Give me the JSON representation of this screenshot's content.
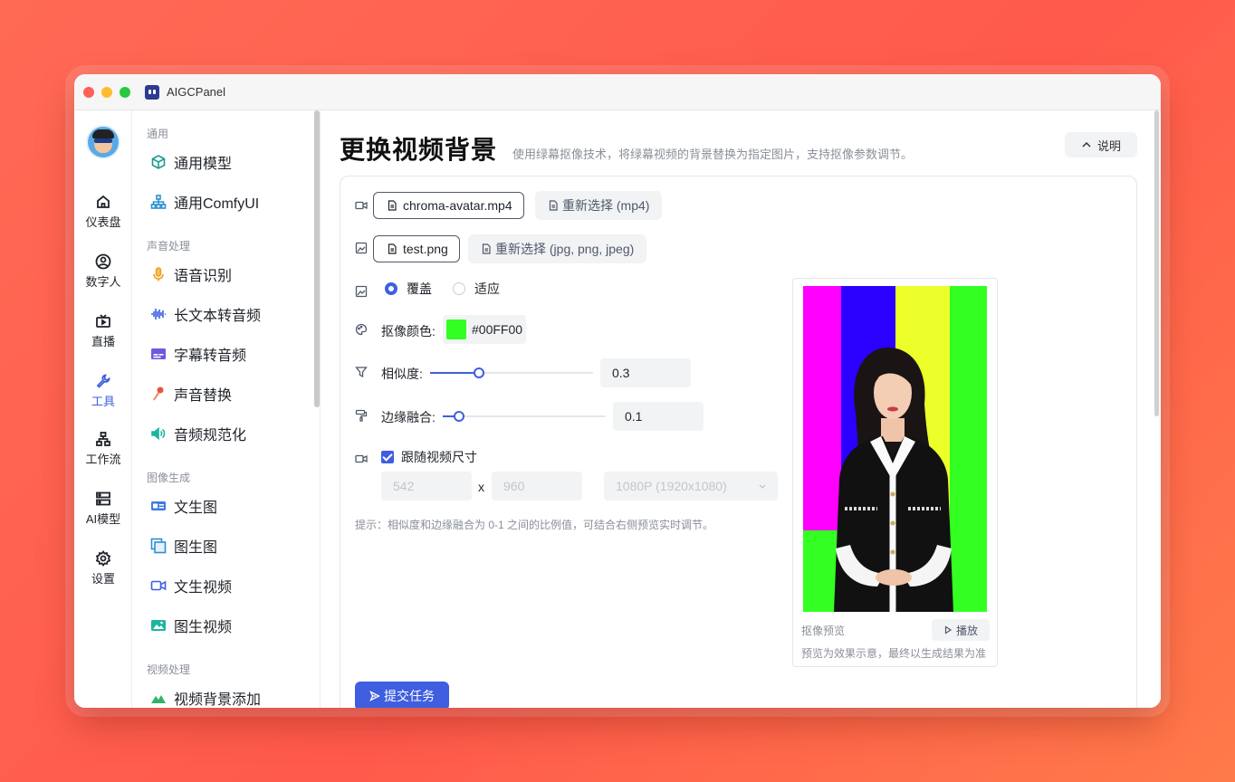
{
  "window": {
    "title": "AIGCPanel"
  },
  "rail": {
    "items": [
      {
        "label": "仪表盘",
        "icon": "home-icon"
      },
      {
        "label": "数字人",
        "icon": "user-circle-icon"
      },
      {
        "label": "直播",
        "icon": "tv-icon"
      },
      {
        "label": "工具",
        "icon": "wrench-icon",
        "active": true
      },
      {
        "label": "工作流",
        "icon": "flow-icon"
      },
      {
        "label": "AI模型",
        "icon": "server-icon"
      },
      {
        "label": "设置",
        "icon": "gear-icon"
      }
    ]
  },
  "menu": {
    "groups": [
      {
        "title": "通用",
        "items": [
          "通用模型",
          "通用ComfyUI"
        ]
      },
      {
        "title": "声音处理",
        "items": [
          "语音识别",
          "长文本转音频",
          "字幕转音频",
          "声音替换",
          "音频规范化"
        ]
      },
      {
        "title": "图像生成",
        "items": [
          "文生图",
          "图生图",
          "文生视频",
          "图生视频"
        ]
      },
      {
        "title": "视频处理",
        "items": [
          "视频背景添加"
        ]
      }
    ]
  },
  "page": {
    "title": "更换视频背景",
    "desc": "使用绿幕抠像技术，将绿幕视频的背景替换为指定图片，支持抠像参数调节。",
    "help": "说明"
  },
  "form": {
    "video_file": "chroma-avatar.mp4",
    "video_reselect": "重新选择 (mp4)",
    "image_file": "test.png",
    "image_reselect": "重新选择 (jpg, png, jpeg)",
    "fit_modes": [
      "覆盖",
      "适应"
    ],
    "fit_selected": "覆盖",
    "key_color_label": "抠像颜色:",
    "key_color": "#00FF00",
    "similarity_label": "相似度:",
    "similarity": "0.3",
    "blend_label": "边缘融合:",
    "blend": "0.1",
    "follow_size_label": "跟随视频尺寸",
    "follow_size_checked": true,
    "width_placeholder": "542",
    "height_placeholder": "960",
    "x_sep": "x",
    "resolution": "1080P (1920x1080)",
    "hint": "提示：相似度和边缘融合为 0-1 之间的比例值，可结合右侧预览实时调节。",
    "submit": "提交任务"
  },
  "preview": {
    "label": "抠像预览",
    "play": "播放",
    "note": "预览为效果示意，最终以生成结果为准"
  },
  "colors": {
    "accent": "#3f5ee0",
    "bar_colors": [
      "#ff00ff",
      "#2b00ff",
      "#ecff2a",
      "#33ff22"
    ],
    "bottom_colors": [
      "#33ff22",
      "#ff00ff",
      "#2f8bff",
      "#ff00ff",
      "#33ff22"
    ]
  }
}
